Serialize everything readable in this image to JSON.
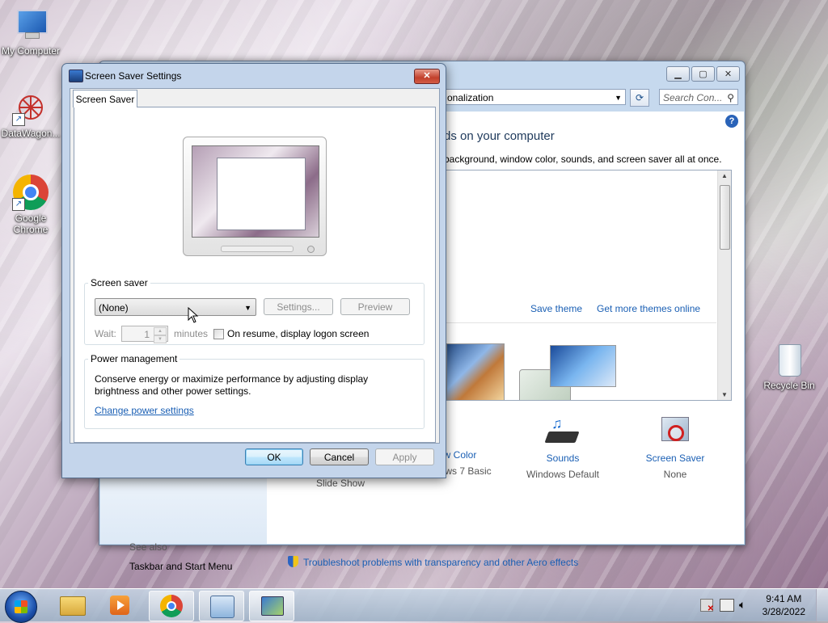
{
  "desktop": {
    "icons": [
      {
        "label": "My Computer"
      },
      {
        "label": "DataWagon..."
      },
      {
        "label": "Google Chrome"
      },
      {
        "label": "Recycle Bin"
      }
    ]
  },
  "background_window": {
    "address": "onalization",
    "search_placeholder": "Search Con...",
    "heading": "ds on your computer",
    "subheading": "background, window color, sounds, and screen saver all at once.",
    "links": {
      "save_theme": "Save theme",
      "more_themes": "Get more themes online"
    },
    "bottom_items": [
      {
        "label": "ow Color",
        "sub": "Windows 7 Basic"
      },
      {
        "label": "Sounds",
        "sub": "Windows Default"
      },
      {
        "label": "Screen Saver",
        "sub": "None"
      }
    ],
    "desktop_background_sub": "Slide Show",
    "see_also": "See also",
    "taskbar_link": "Taskbar and Start Menu",
    "troubleshoot": "Troubleshoot problems with transparency and other Aero effects"
  },
  "dialog": {
    "title": "Screen Saver Settings",
    "tab": "Screen Saver",
    "screen_saver_group": "Screen saver",
    "selected_saver": "(None)",
    "settings_button": "Settings...",
    "preview_button": "Preview",
    "wait_label": "Wait:",
    "wait_value": "1",
    "minutes_label": "minutes",
    "resume_label": "On resume, display logon screen",
    "resume_checked": false,
    "power_group": "Power management",
    "power_text": "Conserve energy or maximize performance by adjusting display brightness and other power settings.",
    "power_link": "Change power settings",
    "ok": "OK",
    "cancel": "Cancel",
    "apply": "Apply"
  },
  "taskbar": {
    "time": "9:41 AM",
    "date": "3/28/2022"
  }
}
